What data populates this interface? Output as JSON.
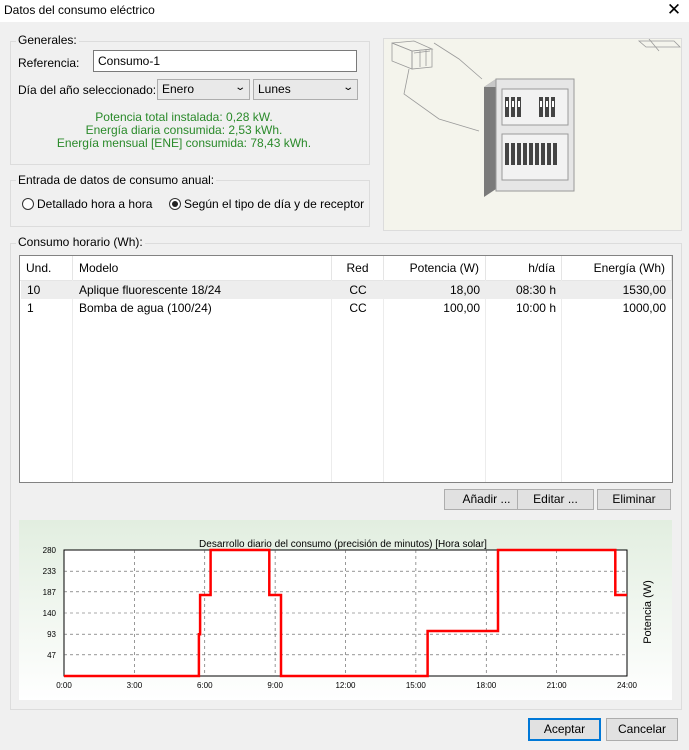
{
  "window": {
    "title": "Datos del consumo eléctrico"
  },
  "generales": {
    "legend": "Generales:",
    "referencia_label": "Referencia:",
    "referencia_value": "Consumo-1",
    "dia_label": "Día del año seleccionado:",
    "mes_value": "Enero",
    "dia_semana_value": "Lunes",
    "stats": [
      "Potencia total instalada: 0,28 kW.",
      "Energía diaria consumida: 2,53 kWh.",
      "Energía mensual [ENE] consumida: 78,43 kWh."
    ]
  },
  "entrada": {
    "legend": "Entrada de datos de consumo anual:",
    "option_1": "Detallado hora a hora",
    "option_2": "Según el tipo de día y de receptor",
    "selected": 2
  },
  "consumo": {
    "legend": "Consumo horario (Wh):",
    "columns": [
      "Und.",
      "Modelo",
      "Red",
      "Potencia (W)",
      "h/día",
      "Energía (Wh)"
    ],
    "rows": [
      [
        "10",
        "Aplique fluorescente 18/24",
        "CC",
        "18,00",
        "08:30 h",
        "1530,00"
      ],
      [
        "1",
        "Bomba de agua (100/24)",
        "CC",
        "100,00",
        "10:00 h",
        "1000,00"
      ]
    ],
    "buttons": {
      "add": "Añadir ...",
      "edit": "Editar ...",
      "delete": "Eliminar"
    }
  },
  "chart_data": {
    "type": "line",
    "title": "Desarrollo diario del consumo (precisión de minutos) [Hora solar]",
    "xlabel": "",
    "ylabel": "Potencia (W)",
    "x_ticks": [
      "0:00",
      "3:00",
      "6:00",
      "9:00",
      "12:00",
      "15:00",
      "18:00",
      "21:00",
      "24:00"
    ],
    "y_ticks": [
      "47",
      "93",
      "140",
      "187",
      "233",
      "280"
    ],
    "xlim": [
      0,
      24
    ],
    "ylim": [
      0,
      280
    ],
    "grid": true,
    "line_color": "#ff0000",
    "series": [
      {
        "x": [
          0,
          5.75,
          5.75,
          5.8,
          5.8,
          6.25,
          6.25,
          8.75,
          8.75,
          9.25,
          9.25,
          15.5,
          15.5,
          18.5,
          18.5,
          23.5,
          23.5,
          24
        ],
        "y": [
          0,
          0,
          93,
          93,
          180,
          180,
          280,
          280,
          180,
          180,
          0,
          0,
          100,
          100,
          280,
          280,
          180,
          180
        ]
      }
    ]
  },
  "footer": {
    "accept": "Aceptar",
    "cancel": "Cancelar"
  }
}
